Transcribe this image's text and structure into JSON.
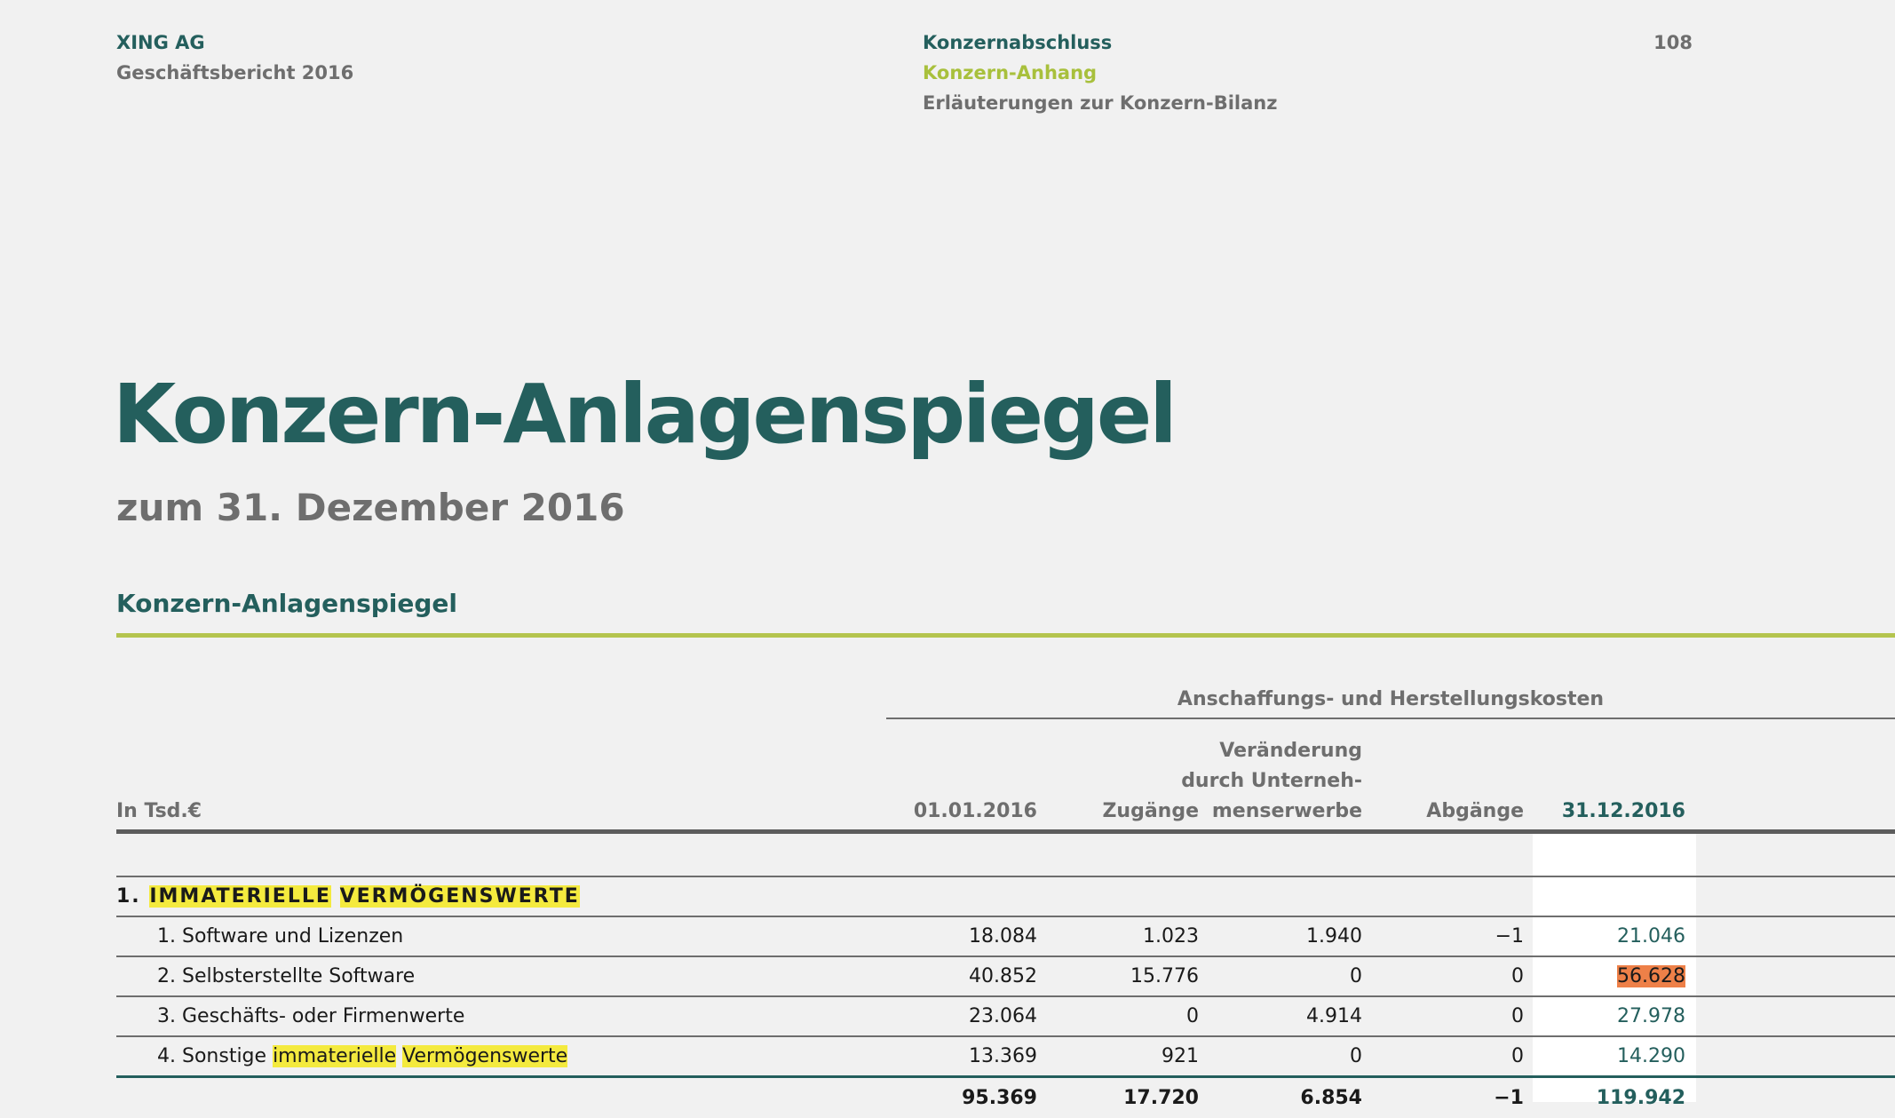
{
  "header": {
    "company": "XING AG",
    "report": "Geschäftsbericht 2016",
    "nav_section": "Konzernabschluss",
    "nav_subsection": "Konzern-Anhang",
    "nav_page_topic": "Erläuterungen zur Konzern-Bilanz",
    "page_number": "108"
  },
  "title": "Konzern-Anlagenspiegel",
  "subtitle": "zum 31. Dezember 2016",
  "section_title": "Konzern-Anlagenspiegel",
  "table": {
    "group_header": "Anschaffungs- und Herstellungskosten",
    "unit_label": "In Tsd.€",
    "columns": {
      "c1": "01.01.2016",
      "c2": "Zugänge",
      "c3_line1": "Veränderung",
      "c3_line2": "durch Unterneh-",
      "c3_line3": "menserwerbe",
      "c4": "Abgänge",
      "c5": "31.12.2016"
    },
    "category": {
      "number": "1.",
      "word1": "IMMATERIELLE",
      "word2": "VERMÖGENSWERTE"
    },
    "rows": [
      {
        "label": "1. Software und Lizenzen",
        "v1": "18.084",
        "v2": "1.023",
        "v3": "1.940",
        "v4": "−1",
        "v5": "21.046"
      },
      {
        "label": "2. Selbsterstellte Software",
        "v1": "40.852",
        "v2": "15.776",
        "v3": "0",
        "v4": "0",
        "v5": "56.628"
      },
      {
        "label": "3. Geschäfts- oder Firmenwerte",
        "v1": "23.064",
        "v2": "0",
        "v3": "4.914",
        "v4": "0",
        "v5": "27.978"
      },
      {
        "label_prefix": "4. Sonstige",
        "label_hl1": "immaterielle",
        "label_hl2": "Vermögenswerte",
        "v1": "13.369",
        "v2": "921",
        "v3": "0",
        "v4": "0",
        "v5": "14.290"
      }
    ],
    "total": {
      "v1": "95.369",
      "v2": "17.720",
      "v3": "6.854",
      "v4": "−1",
      "v5": "119.942"
    }
  },
  "colors": {
    "teal": "#245f5d",
    "accent_green": "#a8c03c",
    "highlight_yellow": "#f4ea3e",
    "highlight_orange": "#ee8048"
  }
}
